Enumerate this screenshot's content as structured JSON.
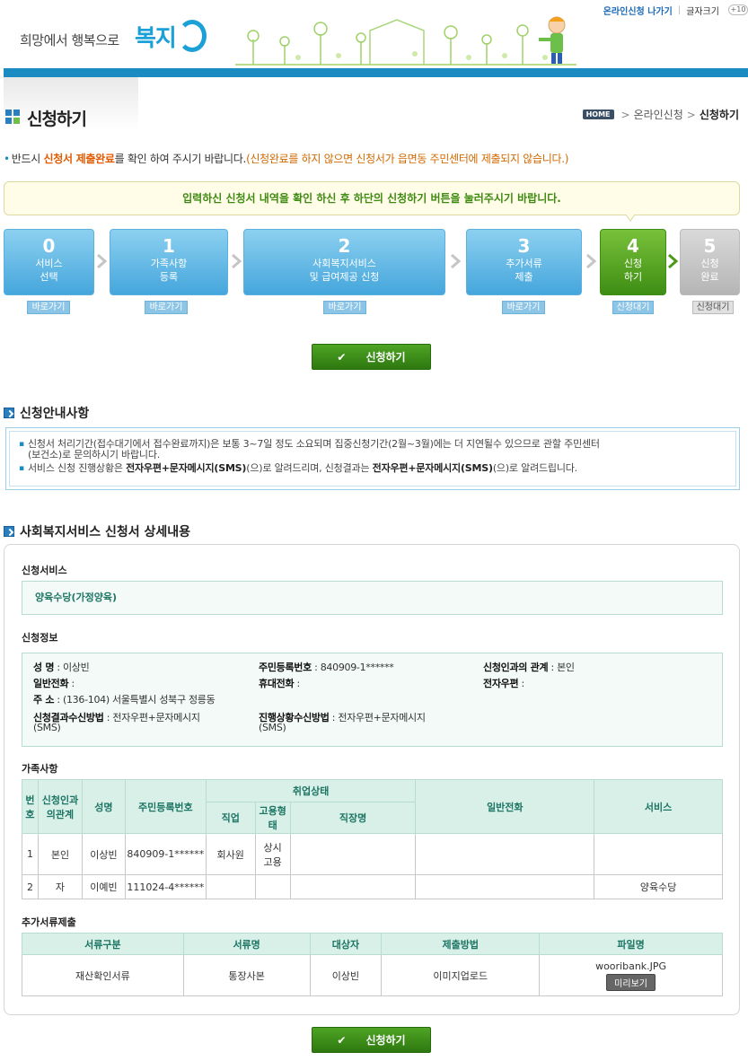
{
  "header": {
    "slogan": "희망에서 행복으로",
    "logo": "복지",
    "top_links": {
      "online": "온라인신청 나가기",
      "font_size": "글자크기",
      "zoom_icon": "+10"
    }
  },
  "page": {
    "title": "신청하기",
    "breadcrumb": {
      "home": "HOME",
      "parent": "온라인신청",
      "current": "신청하기"
    }
  },
  "notice": {
    "prefix": "반드시",
    "emphasis": "신청서 제출완료",
    "middle": "를 확인 하여 주시기 바랍니다.",
    "note": "(신청완료를 하지 않으면 신청서가 읍면동 주민센터에 제출되지 않습니다.)"
  },
  "confirm_message": "입력하신 신청서 내역을 확인 하신 후 하단의 신청하기 버튼을 눌러주시기 바랍니다.",
  "steps": [
    {
      "num": "0",
      "line1": "서비스",
      "line2": "선택",
      "button": "바로가기"
    },
    {
      "num": "1",
      "line1": "가족사항",
      "line2": "등록",
      "button": "바로가기"
    },
    {
      "num": "2",
      "line1": "사회복지서비스",
      "line2": "및 급여제공 신청",
      "button": "바로가기"
    },
    {
      "num": "3",
      "line1": "추가서류",
      "line2": "제출",
      "button": "바로가기"
    },
    {
      "num": "4",
      "line1": "신청",
      "line2": "하기",
      "button": "신청대기"
    },
    {
      "num": "5",
      "line1": "신청",
      "line2": "완료",
      "button": "신청대기"
    }
  ],
  "apply_button": "신청하기",
  "guide": {
    "title": "신청안내사항",
    "item1": "신청서 처리기간(접수대기에서 접수완료까지)은 보통 3~7일 정도 소요되며 집중신청기간(2월~3월)에는 더 지연될수 있으므로 관할 주민센터",
    "item1b": "(보건소)로 문의하시기 바랍니다.",
    "item2_a": "서비스 신청 진행상황은 ",
    "item2_b": "전자우편+문자메시지(SMS)",
    "item2_c": "(으)로 알려드리며, 신청결과는 ",
    "item2_d": "전자우편+문자메시지(SMS)",
    "item2_e": "(으)로 알려드립니다."
  },
  "detail": {
    "title": "사회복지서비스 신청서 상세내용",
    "service_label": "신청서비스",
    "service_value": "양육수당(가정양육)",
    "info_label": "신청정보",
    "info": {
      "name_k": "성 명",
      "name_v": "이상빈",
      "rrn_k": "주민등록번호",
      "rrn_v": "840909-1******",
      "rel_k": "신청인과의 관계",
      "rel_v": "본인",
      "phone_k": "일반전화",
      "phone_v": "",
      "mobile_k": "휴대전화",
      "mobile_v": "",
      "email_k": "전자우편",
      "email_v": "",
      "addr_k": "주 소",
      "addr_v": "(136-104) 서울특별시 성북구 정릉동",
      "result_k": "신청결과수신방법",
      "result_v1": "전자우편+문자메시지",
      "result_v2": "(SMS)",
      "progress_k": "진행상황수신방법",
      "progress_v1": "전자우편+문자메시지",
      "progress_v2": "(SMS)"
    },
    "family_label": "가족사항",
    "family_headers": {
      "no": "번호",
      "rel": "신청인과의관계",
      "name": "성명",
      "rrn": "주민등록번호",
      "job_status": "취업상태",
      "job": "직업",
      "employ": "고용형태",
      "workplace": "직장명",
      "phone": "일반전화",
      "service": "서비스"
    },
    "family_rows": [
      {
        "no": "1",
        "rel": "본인",
        "name": "이상빈",
        "rrn": "840909-1******",
        "job": "회사원",
        "employ1": "상시",
        "employ2": "고용",
        "workplace": "",
        "phone": "",
        "service": ""
      },
      {
        "no": "2",
        "rel": "자",
        "name": "이예빈",
        "rrn": "111024-4******",
        "job": "",
        "employ1": "",
        "employ2": "",
        "workplace": "",
        "phone": "",
        "service": "양육수당"
      }
    ],
    "docs_label": "추가서류제출",
    "doc_headers": {
      "type": "서류구분",
      "name": "서류명",
      "target": "대상자",
      "method": "제출방법",
      "file": "파일명"
    },
    "doc_row": {
      "type": "재산확인서류",
      "name": "통장사본",
      "target": "이상빈",
      "method": "이미지업로드",
      "file": "wooribank.JPG",
      "preview": "미리보기"
    }
  }
}
